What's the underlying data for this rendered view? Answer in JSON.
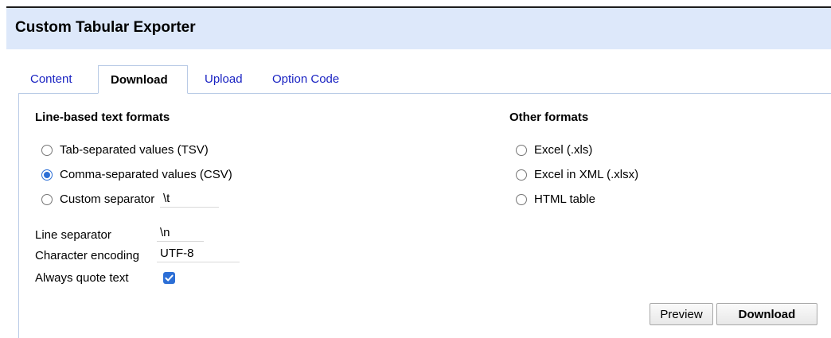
{
  "dialog": {
    "title": "Custom Tabular Exporter"
  },
  "tabs": [
    {
      "label": "Content",
      "active": false
    },
    {
      "label": "Download",
      "active": true
    },
    {
      "label": "Upload",
      "active": false
    },
    {
      "label": "Option Code",
      "active": false
    }
  ],
  "line_formats": {
    "heading": "Line-based text formats",
    "options": [
      {
        "label": "Tab-separated values (TSV)",
        "checked": false
      },
      {
        "label": "Comma-separated values (CSV)",
        "checked": true
      },
      {
        "label": "Custom separator",
        "checked": false
      }
    ],
    "custom_separator_value": "\\t"
  },
  "other_formats": {
    "heading": "Other formats",
    "options": [
      {
        "label": "Excel (.xls)",
        "checked": false
      },
      {
        "label": "Excel in XML (.xlsx)",
        "checked": false
      },
      {
        "label": "HTML table",
        "checked": false
      }
    ]
  },
  "settings": {
    "line_separator_label": "Line separator",
    "line_separator_value": "\\n",
    "encoding_label": "Character encoding",
    "encoding_value": "UTF-8",
    "quote_label": "Always quote text",
    "quote_checked": true
  },
  "buttons": {
    "preview": "Preview",
    "download": "Download"
  },
  "colors": {
    "accent": "#2c6fd6",
    "header_bg": "#dde8fa",
    "link": "#1a23c2"
  }
}
